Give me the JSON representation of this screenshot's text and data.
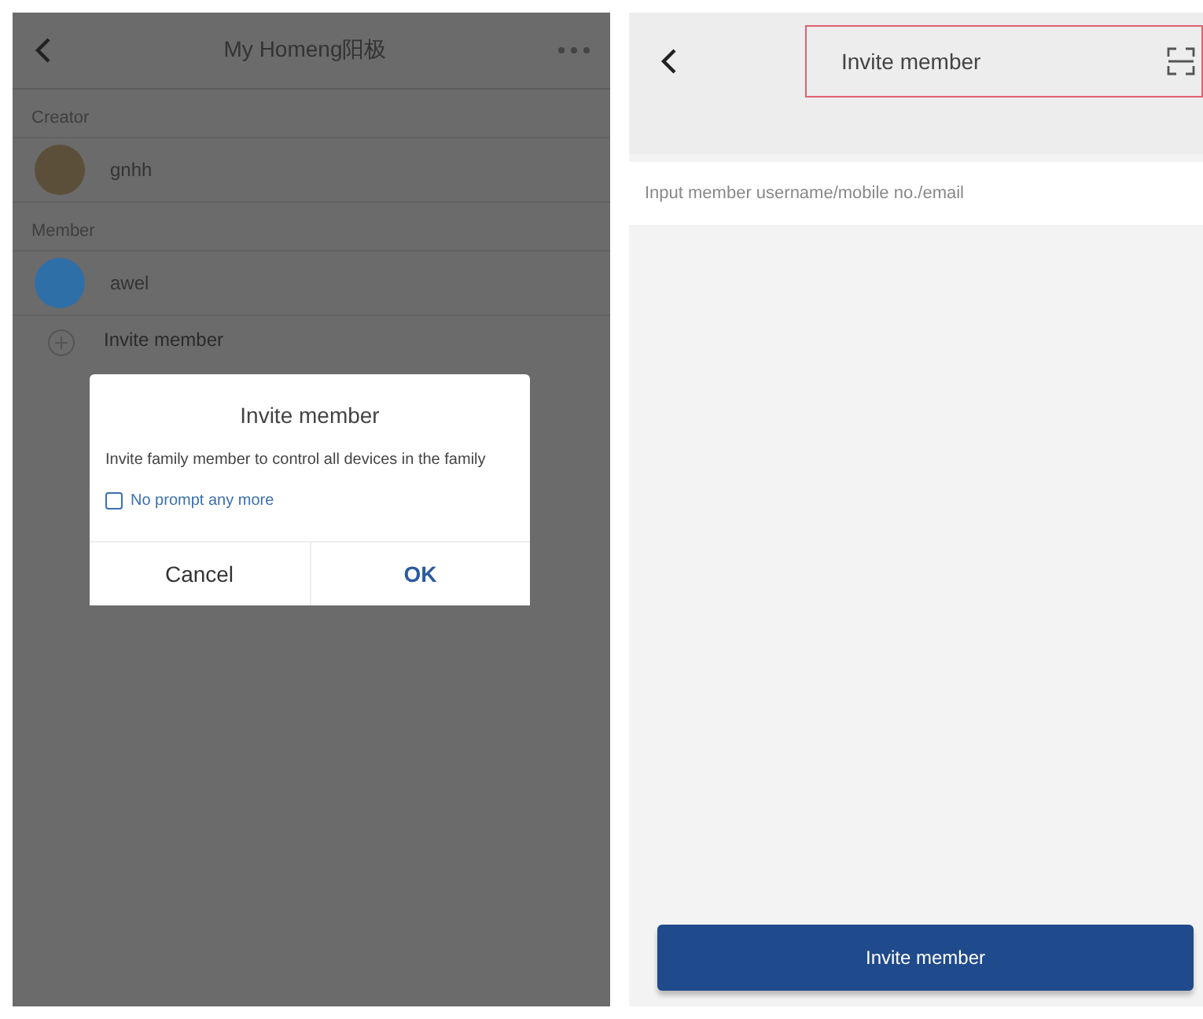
{
  "home_screen": {
    "title": "My Homeng阳极",
    "sections": [
      {
        "label": "Creator",
        "members": [
          {
            "name": "gnhh",
            "kind": "photo"
          }
        ]
      },
      {
        "label": "Member",
        "members": [
          {
            "name": "awel",
            "kind": "icon"
          }
        ]
      }
    ],
    "invite_row": "Invite member"
  },
  "dialog": {
    "title": "Invite member",
    "message": "Invite family member to control all devices in the family",
    "checkbox": {
      "label": "No prompt any more",
      "checked": false
    },
    "buttons": [
      {
        "label": "Cancel",
        "kind": "cancel"
      },
      {
        "label": "OK",
        "kind": "confirm"
      }
    ]
  },
  "invite_screen": {
    "title": "Invite member",
    "input": {
      "placeholder": "Input member username/mobile no./email"
    },
    "button": "Invite member"
  }
}
